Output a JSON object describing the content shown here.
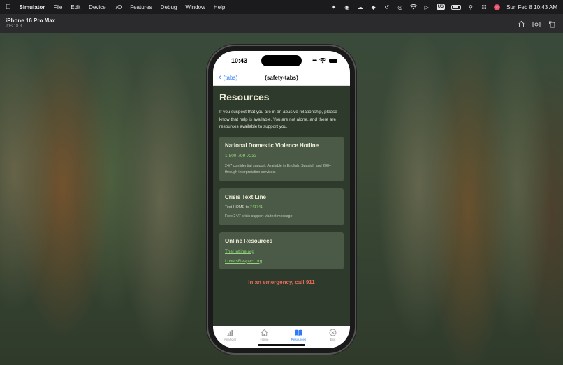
{
  "menubar": {
    "app_name": "Simulator",
    "menus": [
      "File",
      "Edit",
      "Device",
      "I/O",
      "Features",
      "Debug",
      "Window",
      "Help"
    ],
    "input_source": "US",
    "datetime": "Sun Feb 8  10:43 AM"
  },
  "simulator": {
    "device": "iPhone 16 Pro Max",
    "os": "iOS 18.3"
  },
  "phone": {
    "time": "10:43",
    "nav": {
      "back_label": "(tabs)",
      "title": "(safety-tabs)"
    },
    "page": {
      "heading": "Resources",
      "intro": "If you suspect that you are in an abusive relationship, please know that help is available. You are not alone, and there are resources available to support you.",
      "cards": [
        {
          "title": "National Domestic Violence Hotline",
          "link": "1-800-799-7233",
          "desc": "24/7 confidential support. Available in English, Spanish and 200+ through interpretation services."
        },
        {
          "title": "Crisis Text Line",
          "text_prefix": "Text HOME to ",
          "link": "741741",
          "desc": "Free 24/7 crisis support via text message."
        },
        {
          "title": "Online Resources",
          "links": [
            "TheHotline.org",
            "LoveIsRespect.org"
          ]
        }
      ],
      "emergency": "In an emergency, call 911"
    },
    "tabs": [
      {
        "label": "Analyzer",
        "icon": "chart-icon",
        "active": false
      },
      {
        "label": "Home",
        "icon": "home-icon",
        "active": false
      },
      {
        "label": "Resources",
        "icon": "book-icon",
        "active": true
      },
      {
        "label": "Exit",
        "icon": "close-circle-icon",
        "active": false
      }
    ],
    "colors": {
      "background": "#2e3b2c",
      "card": "#4a5a47",
      "link": "#93d57a",
      "emergency": "#e86a5c",
      "accent": "#2f7bf6"
    }
  }
}
